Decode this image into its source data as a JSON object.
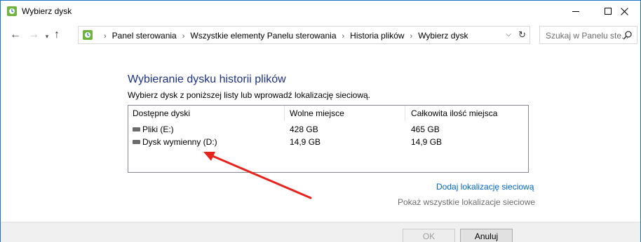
{
  "window": {
    "title": "Wybierz dysk"
  },
  "nav": {
    "breadcrumbs": [
      "Panel sterowania",
      "Wszystkie elementy Panelu sterowania",
      "Historia plików",
      "Wybierz dysk"
    ],
    "search_placeholder": "Szukaj w Panelu ste..."
  },
  "main": {
    "heading": "Wybieranie dysku historii plików",
    "subtext": "Wybierz dysk z poniższej listy lub wprowadź lokalizację sieciową.",
    "table": {
      "columns": [
        "Dostępne dyski",
        "Wolne miejsce",
        "Całkowita ilość miejsca"
      ],
      "rows": [
        {
          "name": "Pliki (E:)",
          "free": "428 GB",
          "total": "465 GB",
          "icon": "drive-icon"
        },
        {
          "name": "Dysk wymienny (D:)",
          "free": "14,9 GB",
          "total": "14,9 GB",
          "icon": "removable-drive-icon"
        }
      ]
    },
    "link_add_network": "Dodaj lokalizację sieciową",
    "link_show_all": "Pokaż wszystkie lokalizacje sieciowe"
  },
  "buttons": {
    "ok": "OK",
    "cancel": "Anuluj"
  },
  "colors": {
    "heading": "#1e3287",
    "link": "#0066cc",
    "annotation_arrow": "#e8231d",
    "window_border": "#1e74c9"
  }
}
